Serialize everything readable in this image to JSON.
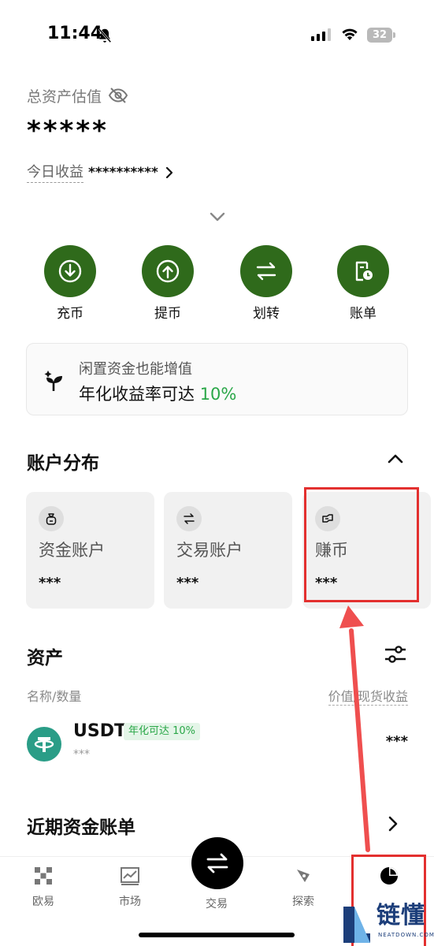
{
  "status_bar": {
    "time": "11:44",
    "battery": "32"
  },
  "summary": {
    "total_label": "总资产估值",
    "total_value": "*****",
    "today_label": "今日收益",
    "today_value": "**********"
  },
  "quick_actions": [
    {
      "label": "充币",
      "icon": "deposit-icon"
    },
    {
      "label": "提币",
      "icon": "withdraw-icon"
    },
    {
      "label": "划转",
      "icon": "transfer-icon"
    },
    {
      "label": "账单",
      "icon": "bill-icon"
    }
  ],
  "promo": {
    "subtitle": "闲置资金也能增值",
    "main_text": "年化收益率可达",
    "rate": "10%"
  },
  "accounts": {
    "title": "账户分布",
    "items": [
      {
        "name": "资金账户",
        "value": "***",
        "icon": "bag-icon"
      },
      {
        "name": "交易账户",
        "value": "***",
        "icon": "swap-icon"
      },
      {
        "name": "赚币",
        "value": "***",
        "icon": "piggy-icon"
      }
    ]
  },
  "assets": {
    "title": "资产",
    "col_left": "名称/数量",
    "col_right": "价值/现货收益",
    "rows": [
      {
        "name": "USDT",
        "badge": "年化可达 10%",
        "amount": "***",
        "value": "***"
      }
    ]
  },
  "bills": {
    "title": "近期资金账单"
  },
  "bottom_nav": [
    {
      "label": "欧易"
    },
    {
      "label": "市场"
    },
    {
      "label": "交易"
    },
    {
      "label": "探索"
    },
    {
      "label": ""
    }
  ],
  "watermark": {
    "text": "链懂",
    "sub": "NEATDOWN.COM"
  },
  "colors": {
    "accent_green": "#2f6a1b",
    "rate_green": "#2aa748",
    "annotation_red": "#e3302f"
  }
}
